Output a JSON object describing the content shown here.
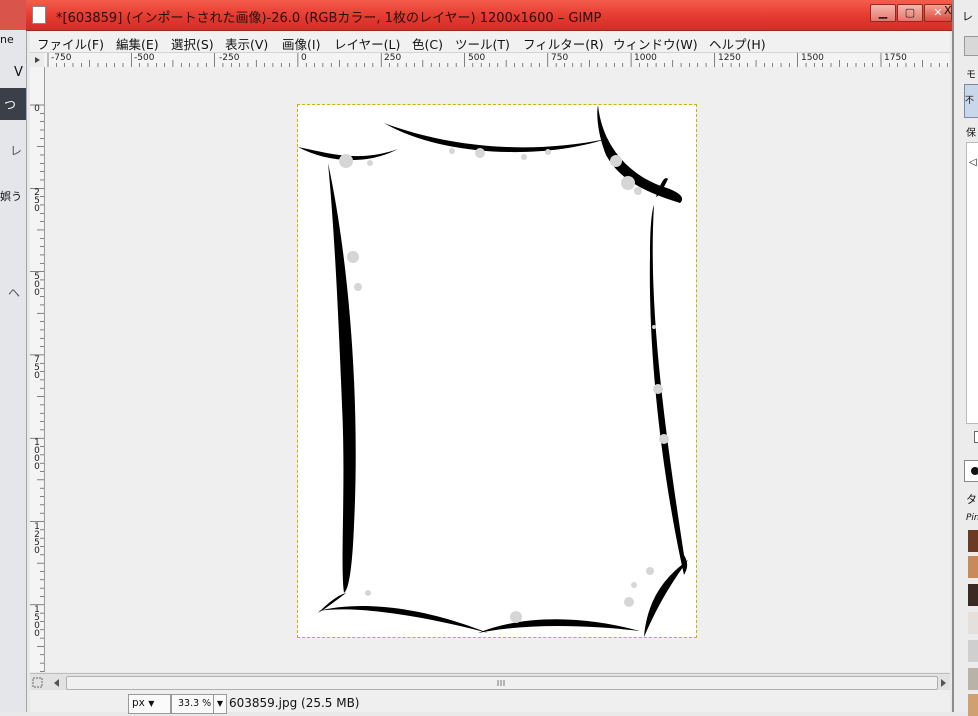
{
  "window": {
    "title": "*[603859] (インポートされた画像)-26.0 (RGBカラー, 1枚のレイヤー) 1200x1600 – GIMP",
    "minimize_label": "▁",
    "maximize_label": "▢",
    "close_label": "✕"
  },
  "menu": [
    {
      "label": "ファイル(F)"
    },
    {
      "label": "編集(E)"
    },
    {
      "label": "選択(S)"
    },
    {
      "label": "表示(V)"
    },
    {
      "label": "画像(I)"
    },
    {
      "label": "レイヤー(L)"
    },
    {
      "label": "色(C)"
    },
    {
      "label": "ツール(T)"
    },
    {
      "label": "フィルター(R)"
    },
    {
      "label": "ウィンドウ(W)"
    },
    {
      "label": "ヘルプ(H)"
    }
  ],
  "rulers": {
    "horizontal_labels": [
      "-750",
      "-500",
      "-250",
      "0",
      "250",
      "500",
      "750",
      "1000",
      "1250",
      "1500",
      "1750"
    ],
    "vertical_labels": [
      "0",
      "250",
      "500",
      "750",
      "1000",
      "1250",
      "1500"
    ]
  },
  "status": {
    "unit": "px",
    "zoom": "33.3 %",
    "file_info": "603859.jpg (25.5 MB)"
  },
  "background_app": {
    "text_fragments": [
      "ne",
      "V",
      "つ",
      "レ",
      "娯う",
      "ヘ"
    ]
  },
  "dock": {
    "top_label": "レ",
    "close_label": "X",
    "mode_label": "モ",
    "mode_value": "不",
    "lock_label": "保",
    "tab_label": "タ",
    "brush_label": "Pin"
  },
  "colors": {
    "titlebar": "#e53a2f",
    "selection_outline": "#c9b400",
    "frame_stroke": "#000000"
  }
}
